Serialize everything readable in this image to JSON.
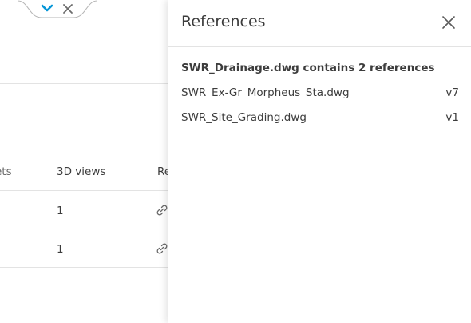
{
  "viewer_tab": {
    "chevron_icon": "chevron-down-icon",
    "close_icon": "close-icon",
    "accent_color": "#0696d7"
  },
  "table": {
    "columns": [
      "ets",
      "3D views",
      "Re"
    ],
    "rows": [
      {
        "views_3d": "1",
        "ref_icon": "link-icon"
      },
      {
        "views_3d": "1",
        "ref_icon": "link-icon"
      }
    ]
  },
  "references_panel": {
    "title": "References",
    "close_icon": "close-icon",
    "summary": "SWR_Drainage.dwg contains 2 references",
    "items": [
      {
        "name": "SWR_Ex-Gr_Morpheus_Sta.dwg",
        "version": "v7"
      },
      {
        "name": "SWR_Site_Grading.dwg",
        "version": "v1"
      }
    ]
  }
}
